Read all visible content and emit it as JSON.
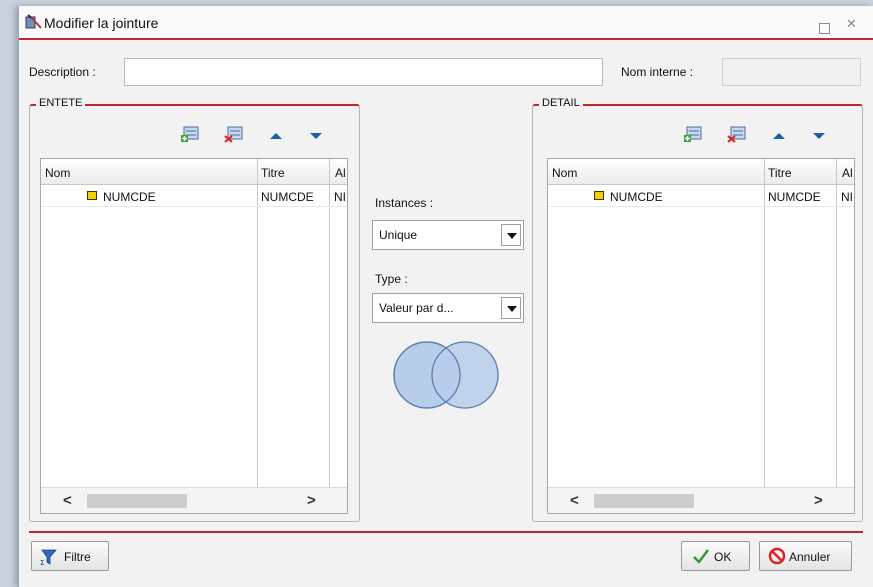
{
  "window": {
    "title": "Modifier la jointure"
  },
  "header": {
    "description_label": "Description :",
    "description_value": "",
    "internal_name_label": "Nom interne :",
    "internal_name_value": ""
  },
  "left_panel": {
    "title": "ENTETE",
    "columns": [
      "Nom",
      "Titre",
      "Al"
    ],
    "rows": [
      {
        "name": "NUMCDE",
        "title": "NUMCDE",
        "alias": "NI"
      }
    ]
  },
  "right_panel": {
    "title": "DETAIL",
    "columns": [
      "Nom",
      "Titre",
      "Al"
    ],
    "rows": [
      {
        "name": "NUMCDE",
        "title": "NUMCDE",
        "alias": "NI"
      }
    ]
  },
  "center": {
    "instances_label": "Instances :",
    "instances_value": "Unique",
    "type_label": "Type :",
    "type_value": "Valeur par d..."
  },
  "footer": {
    "filter_label": "Filtre",
    "ok_label": "OK",
    "cancel_label": "Annuler"
  },
  "colors": {
    "accent": "#c0272d",
    "venn": "#b8cdea"
  }
}
